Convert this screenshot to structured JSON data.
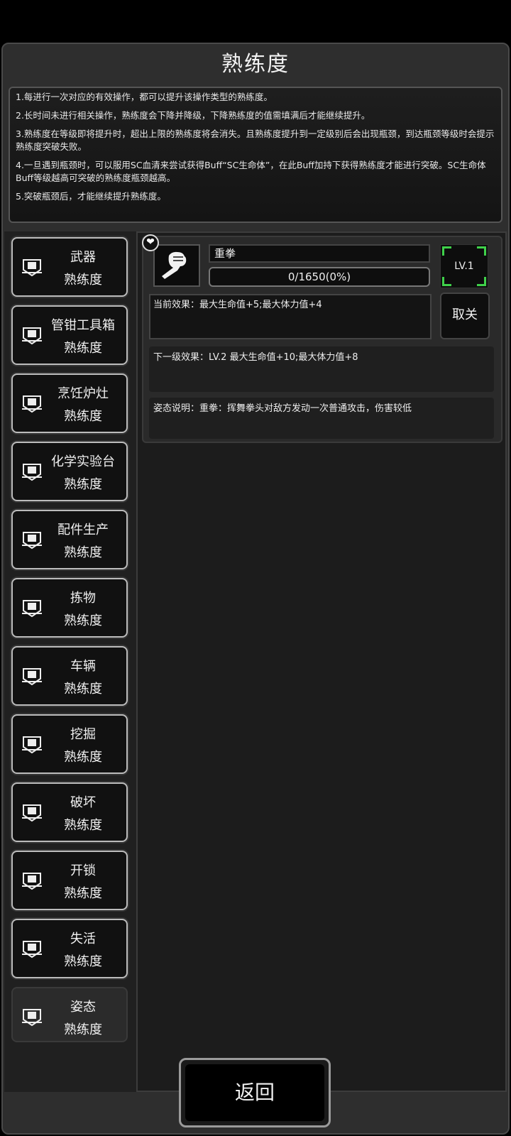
{
  "title": "熟练度",
  "rules": [
    "1.每进行一次对应的有效操作，都可以提升该操作类型的熟练度。",
    "2.长时间未进行相关操作，熟练度会下降并降级，下降熟练度的值需填满后才能继续提升。",
    "3.熟练度在等级即将提升时，超出上限的熟练度将会消失。且熟练度提升到一定级别后会出现瓶颈，到达瓶颈等级时会提示熟练度突破失败。",
    "4.一旦遇到瓶颈时，可以服用SC血清来尝试获得Buff“SC生命体”，在此Buff加持下获得熟练度才能进行突破。SC生命体Buff等级越高可突破的熟练度瓶颈越高。",
    "5.突破瓶颈后，才能继续提升熟练度。"
  ],
  "sidebar": {
    "items": [
      {
        "line1": "武器",
        "line2": "熟练度"
      },
      {
        "line1": "管钳工具箱",
        "line2": "熟练度"
      },
      {
        "line1": "烹饪炉灶",
        "line2": "熟练度"
      },
      {
        "line1": "化学实验台",
        "line2": "熟练度"
      },
      {
        "line1": "配件生产",
        "line2": "熟练度"
      },
      {
        "line1": "拣物",
        "line2": "熟练度"
      },
      {
        "line1": "车辆",
        "line2": "熟练度"
      },
      {
        "line1": "挖掘",
        "line2": "熟练度"
      },
      {
        "line1": "破坏",
        "line2": "熟练度"
      },
      {
        "line1": "开锁",
        "line2": "熟练度"
      },
      {
        "line1": "失活",
        "line2": "熟练度"
      },
      {
        "line1": "姿态",
        "line2": "熟练度"
      }
    ],
    "active_index": 11
  },
  "detail": {
    "skill_name": "重拳",
    "progress_text": "0/1650(0%)",
    "progress_fraction": 0,
    "level": "LV.1",
    "current_effect": "当前效果：最大生命值+5;最大体力值+4",
    "cancel_label": "取关",
    "next_effect": "下一级效果：LV.2 最大生命值+10;最大体力值+8",
    "description": "姿态说明：重拳：挥舞拳头对敌方发动一次普通攻击，伤害较低",
    "heart_icon": "heart-icon",
    "skill_icon": "fist-icon"
  },
  "footer": {
    "back_label": "返回"
  },
  "colors": {
    "accent_green": "#3fd14a"
  }
}
